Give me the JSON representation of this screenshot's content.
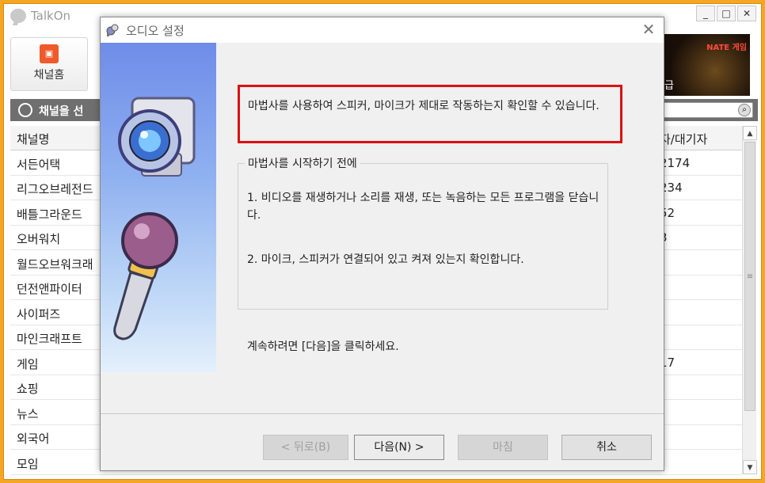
{
  "app": {
    "title": "TalkOn",
    "window_controls": {
      "minimize": "_",
      "maximize": "□",
      "close": "✕"
    },
    "channel_home_label": "채널홈",
    "banner": {
      "brand": "NATE 게임",
      "label": "급"
    },
    "search_bar_title": "채널을 선",
    "list": {
      "header": {
        "name": "채널명",
        "count": "자/대기자"
      },
      "rows": [
        {
          "name": "서든어택",
          "count": "2174"
        },
        {
          "name": "리그오브레전드",
          "count": "234"
        },
        {
          "name": "배틀그라운드",
          "count": "52"
        },
        {
          "name": "오버워치",
          "count": "3"
        },
        {
          "name": "월드오브워크래",
          "count": ""
        },
        {
          "name": "던전앤파이터",
          "count": ""
        },
        {
          "name": "사이퍼즈",
          "count": ""
        },
        {
          "name": "마인크래프트",
          "count": ""
        },
        {
          "name": "게임",
          "count": "17"
        },
        {
          "name": "쇼핑",
          "count": ""
        },
        {
          "name": "뉴스",
          "count": ""
        },
        {
          "name": "외국어",
          "count": ""
        },
        {
          "name": "모임",
          "count": ""
        }
      ]
    }
  },
  "dialog": {
    "title": "오디오 설정",
    "close": "✕",
    "intro": "마법사를 사용하여 스피커, 마이크가 제대로 작동하는지 확인할 수 있습니다.",
    "group": {
      "title": "마법사를 시작하기 전에",
      "items": [
        "1. 비디오를 재생하거나 소리를 재생, 또는 녹음하는 모든 프로그램을 닫습니다.",
        "2. 마이크, 스피커가 연결되어 있고 켜져 있는지 확인합니다."
      ]
    },
    "continue_text": "계속하려면 [다음]을 클릭하세요.",
    "buttons": {
      "back": "< 뒤로(B)",
      "next": "다음(N) >",
      "finish": "마침",
      "cancel": "취소"
    }
  },
  "colors": {
    "frame": "#f5a623",
    "highlight": "#dd1111",
    "sidebar_top": "#6f8ce9"
  }
}
